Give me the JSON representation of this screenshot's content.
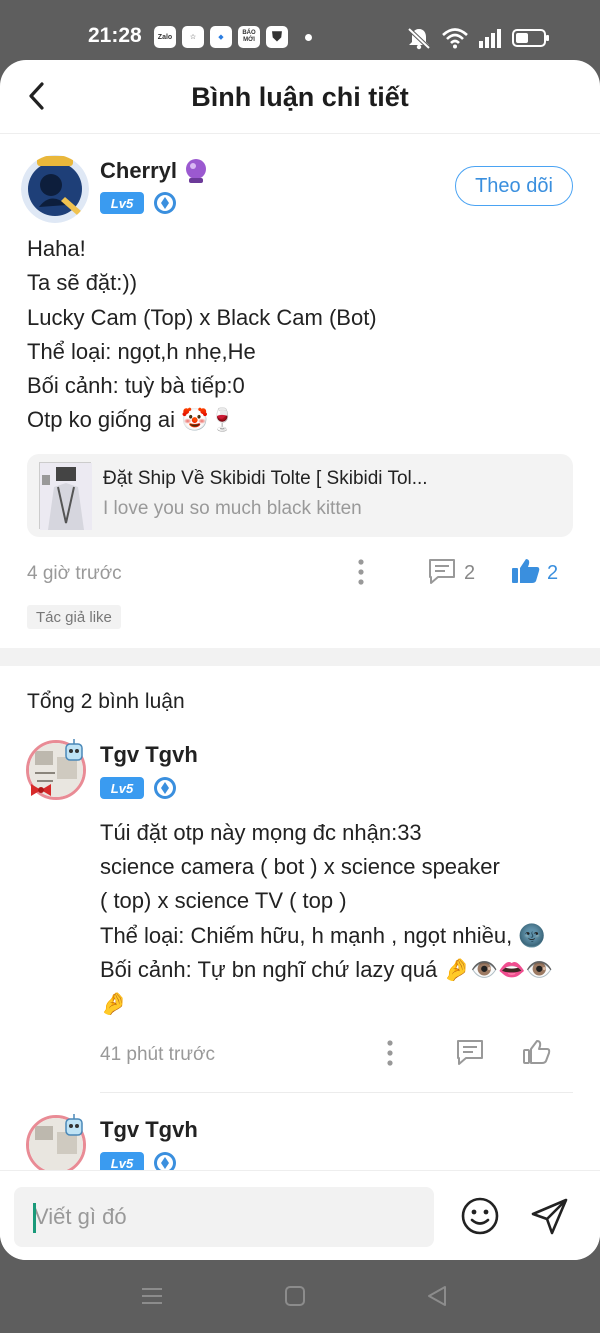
{
  "status_bar": {
    "time": "21:28",
    "apps": [
      "Zalo",
      "☆",
      "◆",
      "BÁO MỚI",
      "⛊"
    ]
  },
  "header": {
    "title": "Bình luận chi tiết"
  },
  "post": {
    "author": "Cherryl",
    "level": "Lv5",
    "follow_label": "Theo dõi",
    "lines": [
      "Haha!",
      "Ta sẽ đặt:))",
      "Lucky Cam (Top) x Black Cam (Bot)",
      "Thể loại: ngọt,h nhẹ,He",
      "Bối cảnh: tuỳ bà tiếp:0",
      "Otp ko giống ai 🤡🍷"
    ],
    "link_title": "Đặt Ship Về Skibidi Tolte [ Skibidi Tol...",
    "link_subtitle": "I love you so much black kitten",
    "time": "4 giờ trước",
    "comment_count": "2",
    "like_count": "2",
    "author_like_tag": "Tác giả like"
  },
  "comments": {
    "total_label": "Tổng 2 bình luận",
    "items": [
      {
        "author": "Tgv Tgvh",
        "level": "Lv5",
        "lines": [
          "Túi đặt otp này mọng đc nhận:33",
          "science camera ( bot ) x science speaker",
          "( top) x science TV ( top )",
          "Thể loại: Chiếm hữu, h mạnh , ngọt nhiều, 🌚",
          "Bối cảnh: Tự bn nghĩ chứ lazy quá 🤌👁️👄👁️",
          "🤌"
        ],
        "time": "41 phút trước"
      },
      {
        "author": "Tgv Tgvh",
        "level": "Lv5"
      }
    ]
  },
  "input": {
    "placeholder": "Viết gì đó"
  },
  "colors": {
    "accent": "#3a8fde",
    "badge": "#3a9bf0",
    "background_dim": "#5e5e5e"
  }
}
